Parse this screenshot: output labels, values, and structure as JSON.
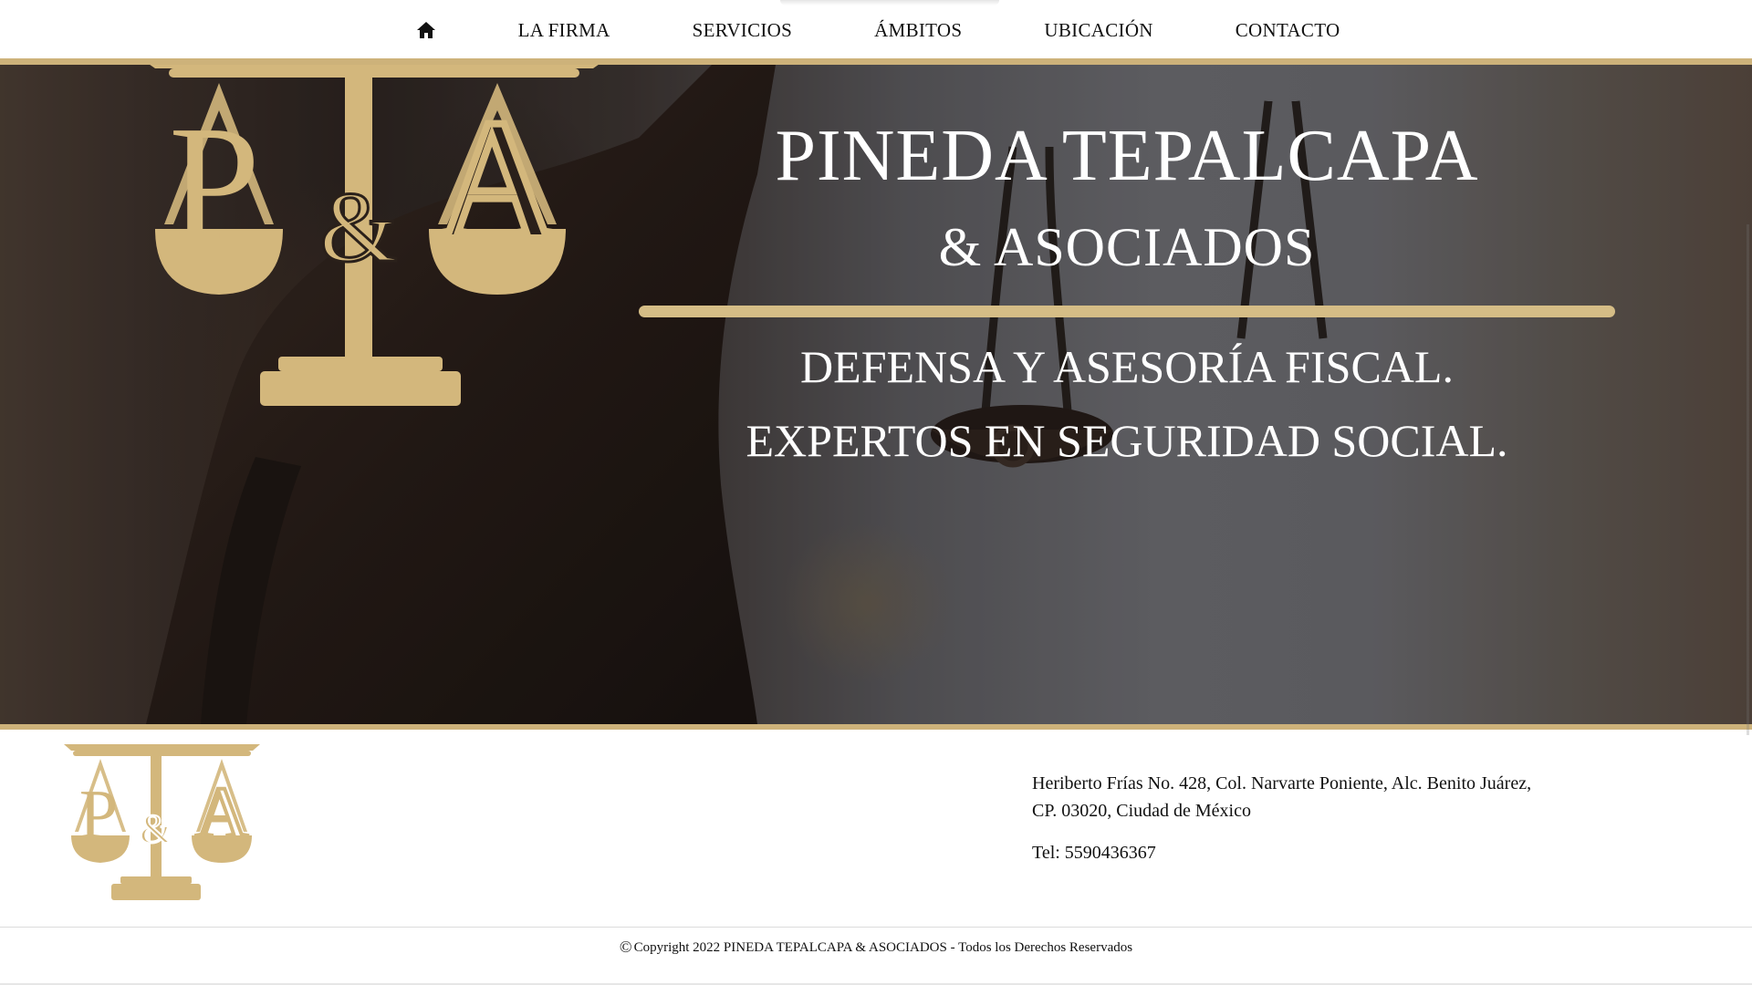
{
  "nav": {
    "home_icon": "home-icon",
    "items": [
      {
        "label": "LA FIRMA"
      },
      {
        "label": "SERVICIOS"
      },
      {
        "label": "ÁMBITOS"
      },
      {
        "label": "UBICACIÓN"
      },
      {
        "label": "CONTACTO"
      }
    ]
  },
  "hero": {
    "title_line1": "PINEDA TEPALCAPA",
    "title_line2": "& ASOCIADOS",
    "tagline_line1": "DEFENSA Y ASESORÍA FISCAL.",
    "tagline_line2": "EXPERTOS EN SEGURIDAD SOCIAL."
  },
  "logo": {
    "letters_left": "P",
    "letters_mid": "&",
    "letters_right": "A"
  },
  "footer": {
    "address_line1": "Heriberto Frías No. 428, Col. Narvarte Poniente, Alc. Benito Juárez,",
    "address_line2": "CP. 03020, Ciudad de México",
    "tel": "Tel: 5590436367",
    "copyright": "Copyright 2022 PINEDA TEPALCAPA & ASOCIADOS - Todos los Derechos Reservados"
  },
  "colors": {
    "gold": "#cdb27a",
    "gold_light": "#d5bd86",
    "text": "#111111"
  }
}
